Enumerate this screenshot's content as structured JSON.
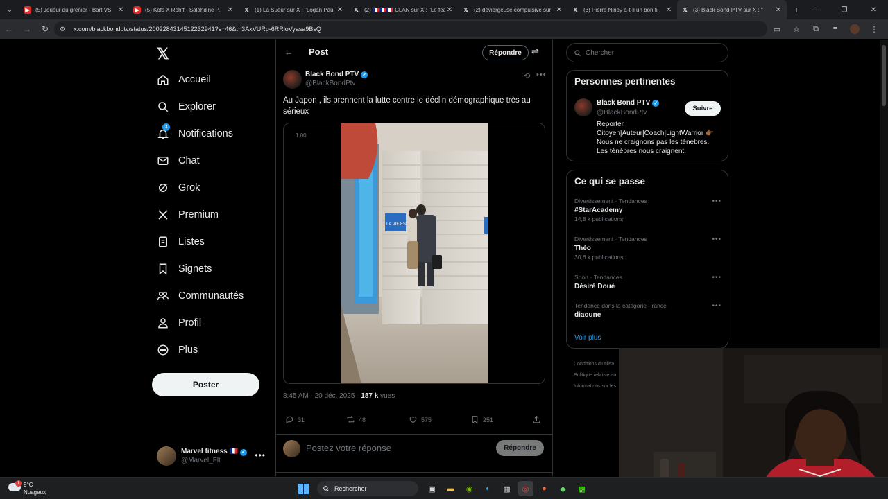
{
  "browser": {
    "tabs": [
      {
        "title": "(5) Joueur du grenier - Bart VS",
        "icon": "youtube-icon"
      },
      {
        "title": "(5) Kofs X Rohff - Salahdine P.",
        "icon": "youtube-icon"
      },
      {
        "title": "(1) La Sueur sur X : \"Logan Paul",
        "icon": "x-icon"
      },
      {
        "title": "(2) 🇫🇷🇫🇷🇫🇷 CLAN sur X : \"Le fea",
        "icon": "x-icon"
      },
      {
        "title": "(2) déviergeuse compulsive sur",
        "icon": "x-icon"
      },
      {
        "title": "(3) Pierre Niney a-t-il un bon fil",
        "icon": "x-icon"
      },
      {
        "title": "(3) Black Bond PTV sur X : \"",
        "icon": "x-icon",
        "active": true
      }
    ],
    "url": "x.com/blackbondptv/status/2002284314512232941?s=46&t=3AxVURp-6RRloVyasa9BsQ"
  },
  "nav": {
    "logo": "𝕏",
    "items": [
      {
        "label": "Accueil",
        "icon": "home-icon"
      },
      {
        "label": "Explorer",
        "icon": "search-icon"
      },
      {
        "label": "Notifications",
        "icon": "bell-icon",
        "badge": "3"
      },
      {
        "label": "Chat",
        "icon": "mail-icon"
      },
      {
        "label": "Grok",
        "icon": "grok-icon"
      },
      {
        "label": "Premium",
        "icon": "x-premium-icon"
      },
      {
        "label": "Listes",
        "icon": "list-icon"
      },
      {
        "label": "Signets",
        "icon": "bookmark-icon"
      },
      {
        "label": "Communautés",
        "icon": "communities-icon"
      },
      {
        "label": "Profil",
        "icon": "person-icon"
      },
      {
        "label": "Plus",
        "icon": "more-circle-icon"
      }
    ],
    "post_button": "Poster",
    "account": {
      "name": "Marvel fitness 🇫🇷",
      "handle": "@Marvel_Flt"
    }
  },
  "post": {
    "header_title": "Post",
    "reply_button": "Répondre",
    "author_name": "Black Bond PTV",
    "author_handle": "@BlackBondPtv",
    "text": "Au Japon , ils prennent la lutte contre le déclin démographique très au sérieux",
    "video_speed": "1.00",
    "video_sign": "LA VIE EST",
    "time": "8:45 AM · 20 déc. 2025 · ",
    "views_count": "187 k",
    "views_label": " vues",
    "stats": {
      "replies": "31",
      "reposts": "48",
      "likes": "575",
      "bookmarks": "251"
    },
    "reply_placeholder": "Postez votre réponse",
    "reply_submit": "Répondre"
  },
  "sidebar": {
    "search_placeholder": "Chercher",
    "relevant": {
      "title": "Personnes pertinentes",
      "name": "Black Bond PTV",
      "handle": "@BlackBondPtv",
      "follow": "Suivre",
      "bio": "Reporter Citoyen|Auteur|Coach|LightWarrior 👉🏾 Nous ne craignons pas les ténèbres. Les ténèbres nous craignent."
    },
    "trends_title": "Ce qui se passe",
    "trends": [
      {
        "category": "Divertissement · Tendances",
        "title": "#StarAcademy",
        "count": "14,8 k publications"
      },
      {
        "category": "Divertissement · Tendances",
        "title": "Théo",
        "count": "30,6 k publications"
      },
      {
        "category": "Sport · Tendances",
        "title": "Désiré Doué",
        "count": ""
      },
      {
        "category": "Tendance dans la catégorie France",
        "title": "diaoune",
        "count": ""
      }
    ],
    "see_more": "Voir plus",
    "footer": [
      "Conditions d'utilisa",
      "Politique relative au",
      "Informations sur les"
    ]
  },
  "taskbar": {
    "temp": "9°C",
    "condition": "Nuageux",
    "weather_badge": "1",
    "search_label": "Rechercher"
  }
}
